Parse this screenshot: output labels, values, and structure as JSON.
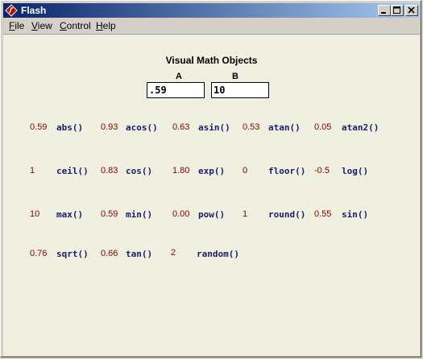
{
  "window": {
    "title": "Flash",
    "minimize": "0",
    "maximize": "1",
    "close": "r"
  },
  "menu": [
    "File",
    "View",
    "Control",
    "Help"
  ],
  "stage": {
    "heading": "Visual Math Objects",
    "label_a": "A",
    "label_b": "B",
    "input_a": ".59",
    "input_b": "10",
    "rows": [
      [
        {
          "value": "0.59",
          "fn": "abs()"
        },
        {
          "value": "0.93",
          "fn": "acos()"
        },
        {
          "value": "0.63",
          "fn": "asin()"
        },
        {
          "value": "0.53",
          "fn": "atan()"
        },
        {
          "value": "0.05",
          "fn": "atan2()"
        }
      ],
      [
        {
          "value": "1",
          "fn": "ceil()"
        },
        {
          "value": "0.83",
          "fn": "cos()"
        },
        {
          "value": "1.80",
          "fn": "exp()"
        },
        {
          "value": "0",
          "fn": "floor()"
        },
        {
          "value": "-0.5",
          "fn": "log()"
        }
      ],
      [
        {
          "value": "10",
          "fn": "max()"
        },
        {
          "value": "0.59",
          "fn": "min()"
        },
        {
          "value": "0.00",
          "fn": "pow()"
        },
        {
          "value": "1",
          "fn": "round()"
        },
        {
          "value": "0.55",
          "fn": "sin()"
        }
      ],
      [
        {
          "value": "0.76",
          "fn": "sqrt()"
        },
        {
          "value": "0.66",
          "fn": "tan()"
        },
        {
          "value": "2",
          "fn": "random()"
        }
      ]
    ]
  }
}
